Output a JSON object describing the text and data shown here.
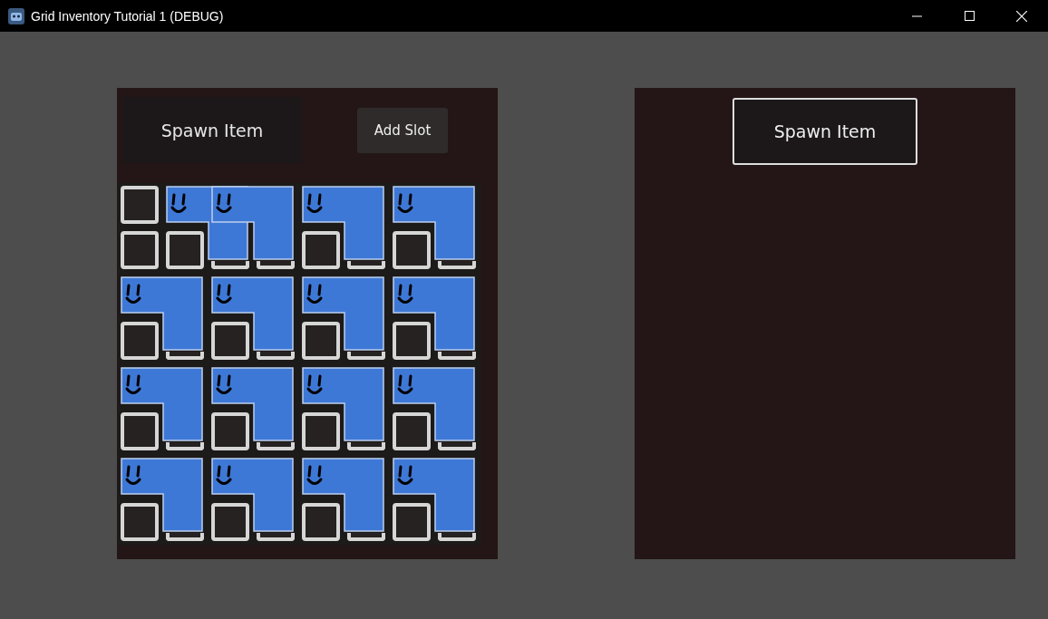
{
  "window": {
    "title": "Grid Inventory Tutorial 1 (DEBUG)"
  },
  "left_panel": {
    "spawn_button": "Spawn Item",
    "add_slot_button": "Add Slot",
    "grid": {
      "rows": [
        {
          "cells": [
            {
              "kind": "slot"
            },
            {
              "kind": "item"
            },
            {
              "kind": "item"
            },
            {
              "kind": "covered"
            },
            {
              "kind": "item"
            },
            {
              "kind": "covered"
            },
            {
              "kind": "item"
            },
            {
              "kind": "covered"
            }
          ]
        },
        {
          "cells": [
            {
              "kind": "slot"
            },
            {
              "kind": "slot"
            },
            {
              "kind": "partial"
            },
            {
              "kind": "partial"
            },
            {
              "kind": "slot"
            },
            {
              "kind": "partial"
            },
            {
              "kind": "slot"
            },
            {
              "kind": "partial"
            }
          ]
        },
        {
          "cells": [
            {
              "kind": "item"
            },
            {
              "kind": "covered"
            },
            {
              "kind": "item"
            },
            {
              "kind": "covered"
            },
            {
              "kind": "item"
            },
            {
              "kind": "covered"
            },
            {
              "kind": "item"
            },
            {
              "kind": "covered"
            }
          ]
        },
        {
          "cells": [
            {
              "kind": "slot"
            },
            {
              "kind": "partial"
            },
            {
              "kind": "slot"
            },
            {
              "kind": "partial"
            },
            {
              "kind": "slot"
            },
            {
              "kind": "partial"
            },
            {
              "kind": "slot"
            },
            {
              "kind": "partial"
            }
          ]
        },
        {
          "cells": [
            {
              "kind": "item"
            },
            {
              "kind": "covered"
            },
            {
              "kind": "item"
            },
            {
              "kind": "covered"
            },
            {
              "kind": "item"
            },
            {
              "kind": "covered"
            },
            {
              "kind": "item"
            },
            {
              "kind": "covered"
            }
          ]
        },
        {
          "cells": [
            {
              "kind": "slot"
            },
            {
              "kind": "partial"
            },
            {
              "kind": "slot"
            },
            {
              "kind": "partial"
            },
            {
              "kind": "slot"
            },
            {
              "kind": "partial"
            },
            {
              "kind": "slot"
            },
            {
              "kind": "partial"
            }
          ]
        },
        {
          "cells": [
            {
              "kind": "item"
            },
            {
              "kind": "covered"
            },
            {
              "kind": "item"
            },
            {
              "kind": "covered"
            },
            {
              "kind": "item"
            },
            {
              "kind": "covered"
            },
            {
              "kind": "item"
            },
            {
              "kind": "covered"
            }
          ]
        },
        {
          "cells": [
            {
              "kind": "slot"
            },
            {
              "kind": "partial"
            },
            {
              "kind": "slot"
            },
            {
              "kind": "partial"
            },
            {
              "kind": "slot"
            },
            {
              "kind": "partial"
            },
            {
              "kind": "slot"
            },
            {
              "kind": "partial"
            }
          ]
        }
      ]
    }
  },
  "right_panel": {
    "spawn_button": "Spawn Item"
  }
}
